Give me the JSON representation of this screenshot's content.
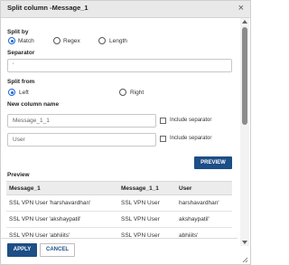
{
  "dialog": {
    "title": "Split column -Message_1",
    "close_glyph": "×"
  },
  "split_by": {
    "label": "Split by",
    "options": [
      {
        "label": "Match",
        "checked": true
      },
      {
        "label": "Regex",
        "checked": false
      },
      {
        "label": "Length",
        "checked": false
      }
    ]
  },
  "separator": {
    "label": "Separator",
    "value": "'"
  },
  "split_from": {
    "label": "Split from",
    "options": [
      {
        "label": "Left",
        "checked": true
      },
      {
        "label": "Right",
        "checked": false
      }
    ]
  },
  "new_column_name": {
    "label": "New column name",
    "fields": [
      {
        "value": "Message_1_1",
        "include_label": "Include separator"
      },
      {
        "value": "User",
        "include_label": "Include separator"
      }
    ]
  },
  "buttons": {
    "preview": "PREVIEW",
    "apply": "APPLY",
    "cancel": "CANCEL"
  },
  "preview": {
    "label": "Preview",
    "columns": [
      "Message_1",
      "Message_1_1",
      "User"
    ],
    "rows": [
      [
        "SSL VPN User 'harshavardhan'",
        "SSL VPN User",
        "harshavardhan'"
      ],
      [
        "SSL VPN User 'akshaypatil'",
        "SSL VPN User",
        "akshaypatil'"
      ],
      [
        "SSL VPN User 'abhiiits'",
        "SSL VPN User",
        "abhiiits'"
      ]
    ]
  },
  "colors": {
    "accent": "#1d4e86",
    "radio_accent": "#1a66d6"
  }
}
